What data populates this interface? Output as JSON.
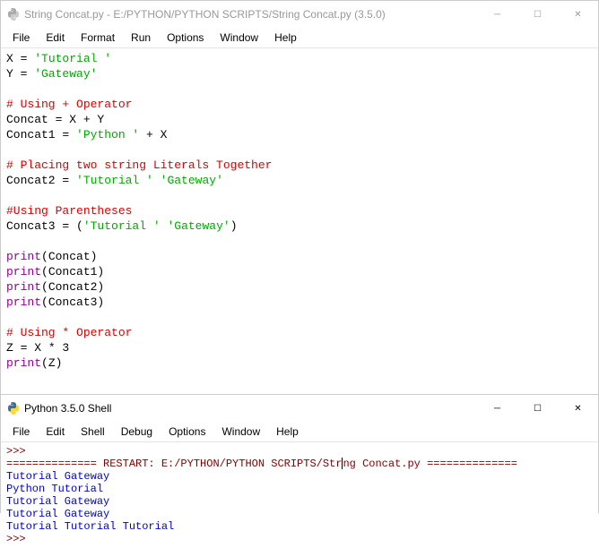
{
  "editor": {
    "title": "String Concat.py - E:/PYTHON/PYTHON SCRIPTS/String Concat.py (3.5.0)",
    "menu": [
      "File",
      "Edit",
      "Format",
      "Run",
      "Options",
      "Window",
      "Help"
    ],
    "code": {
      "l1_var1": "X",
      "l1_eq": " = ",
      "l1_str": "'Tutorial '",
      "l2_var1": "Y",
      "l2_eq": " = ",
      "l2_str": "'Gateway'",
      "l4_com": "# Using + Operator",
      "l5_var": "Concat",
      "l5_eq": " = X + Y",
      "l6_var": "Concat1",
      "l6_eq": " = ",
      "l6_str": "'Python '",
      "l6_rest": " + X",
      "l8_com": "# Placing two string Literals Together",
      "l9_var": "Concat2",
      "l9_eq": " = ",
      "l9_str1": "'Tutorial '",
      "l9_sp": " ",
      "l9_str2": "'Gateway'",
      "l11_com": "#Using Parentheses",
      "l12_var": "Concat3",
      "l12_eq": " = (",
      "l12_str1": "'Tutorial '",
      "l12_sp": " ",
      "l12_str2": "'Gateway'",
      "l12_close": ")",
      "l14_fn": "print",
      "l14_arg": "(Concat)",
      "l15_fn": "print",
      "l15_arg": "(Concat1)",
      "l16_fn": "print",
      "l16_arg": "(Concat2)",
      "l17_fn": "print",
      "l17_arg": "(Concat3)",
      "l19_com": "# Using * Operator",
      "l20_var": "Z",
      "l20_eq": " = X * ",
      "l20_num": "3",
      "l21_fn": "print",
      "l21_arg": "(Z)"
    }
  },
  "shell": {
    "title": "Python 3.5.0 Shell",
    "menu": [
      "File",
      "Edit",
      "Shell",
      "Debug",
      "Options",
      "Window",
      "Help"
    ],
    "output": {
      "prompt": ">>> ",
      "restart_left": "============== RESTART: E:/PYTHON/PYTHON SCRIPTS/Str",
      "restart_right": "ng Concat.py ==============",
      "out1": "Tutorial Gateway",
      "out2": "Python Tutorial ",
      "out3": "Tutorial Gateway",
      "out4": "Tutorial Gateway",
      "out5": "Tutorial Tutorial Tutorial ",
      "prompt2": ">>> "
    }
  },
  "controls": {
    "min": "─",
    "max": "☐",
    "close": "✕"
  }
}
